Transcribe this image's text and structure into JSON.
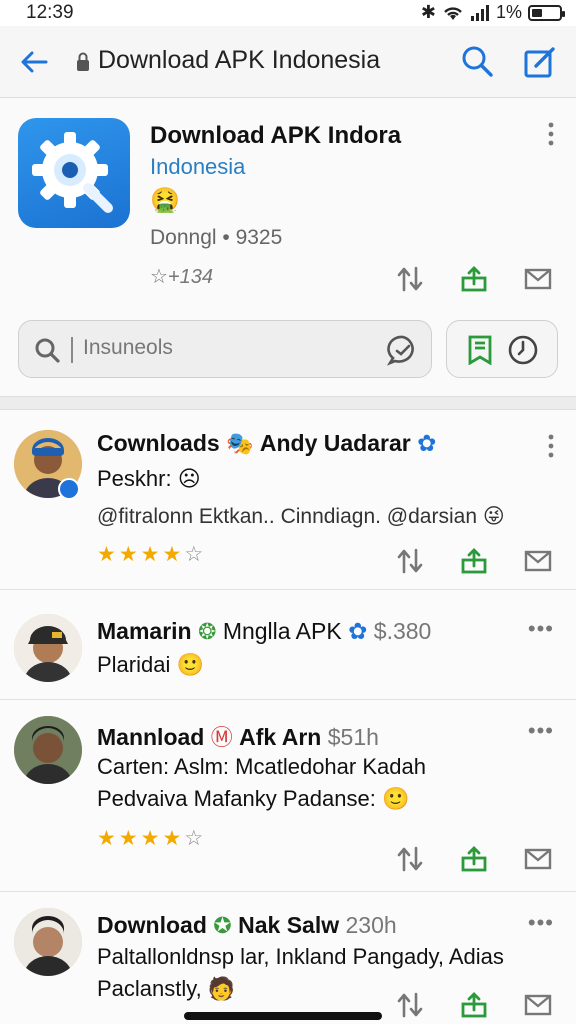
{
  "status": {
    "time": "12:39",
    "battery": "1%",
    "battery_level": 0.4
  },
  "appbar": {
    "title": "Download APK Indonesia",
    "back_icon": "back-arrow-icon",
    "search_icon": "search-icon",
    "compose_icon": "compose-icon"
  },
  "app": {
    "title": "Download APK Indora",
    "subtitle": "Indonesia",
    "emoji": "🤮",
    "downloads": "Donngl • 9325",
    "rating": "☆+134"
  },
  "search": {
    "placeholder": "Insuneols"
  },
  "posts": [
    {
      "title": "Cownloads",
      "badge": "🎭",
      "author": "Andy Uadarar",
      "meta": "",
      "line1": "Peskhr: ☹",
      "line2": "@fitralonn Ektkan.. Cinndiagn. @darsian 😜",
      "stars_on": "★★★★",
      "stars_off": "☆"
    },
    {
      "title": "Mamarin",
      "badge": "❂",
      "author": "Mnglla APK",
      "meta": "$.380",
      "line1": "Plaridai 🙂",
      "line2": ""
    },
    {
      "title": "Mannload",
      "badge": "Ⓜ",
      "author": "Afk Arn",
      "meta": "$51h",
      "line1": "Carten: Aslm: Mcatledohar Kadah",
      "line2": "Pedvaiva Mafanky Padanse: 🙂",
      "stars_on": "★★★★",
      "stars_off": "☆"
    },
    {
      "title": "Download",
      "badge": "✪",
      "author": "Nak Salw",
      "meta": "230h",
      "line1": "Paltallonldnsp lar, Inkland Pangady, Adias",
      "line2": "Paclanstly, 🧑"
    }
  ],
  "colors": {
    "accent": "#1e74d9",
    "green": "#2a9a3b",
    "star": "#f2a900"
  }
}
